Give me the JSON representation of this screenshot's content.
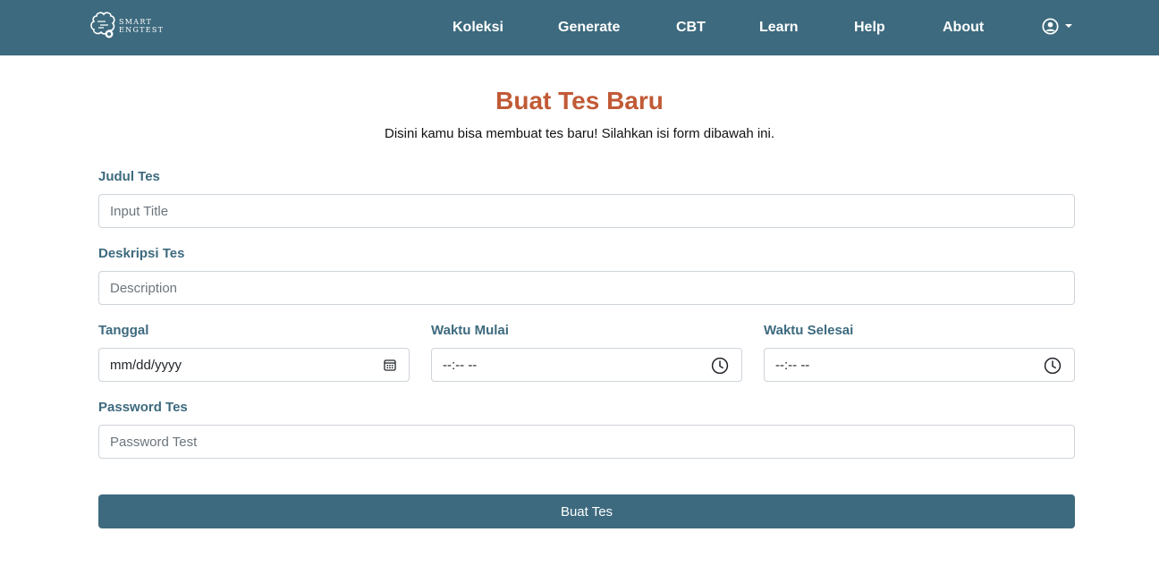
{
  "brand": {
    "line1": "SMART",
    "line2": "ENGTEST"
  },
  "nav": {
    "items": [
      {
        "label": "Koleksi"
      },
      {
        "label": "Generate"
      },
      {
        "label": "CBT"
      },
      {
        "label": "Learn"
      },
      {
        "label": "Help"
      },
      {
        "label": "About"
      }
    ],
    "user_icon": "user-circle-icon",
    "dropdown_icon": "caret-down-icon"
  },
  "page": {
    "title": "Buat Tes Baru",
    "subtitle": "Disini kamu bisa membuat tes baru! Silahkan isi form dibawah ini."
  },
  "form": {
    "judul": {
      "label": "Judul Tes",
      "placeholder": "Input Title"
    },
    "deskripsi": {
      "label": "Deskripsi Tes",
      "placeholder": "Description"
    },
    "tanggal": {
      "label": "Tanggal",
      "value": "mm/dd/yyyy",
      "icon": "calendar-icon"
    },
    "waktu_mulai": {
      "label": "Waktu Mulai",
      "value": "--:-- --",
      "icon": "clock-icon"
    },
    "waktu_selesai": {
      "label": "Waktu Selesai",
      "value": "--:-- --",
      "icon": "clock-icon"
    },
    "password": {
      "label": "Password Tes",
      "placeholder": "Password Test"
    },
    "submit_label": "Buat Tes"
  },
  "colors": {
    "navbar": "#3d6a7e",
    "title": "#c15a36",
    "label": "#3d6a7e",
    "button": "#3d6a7e"
  }
}
